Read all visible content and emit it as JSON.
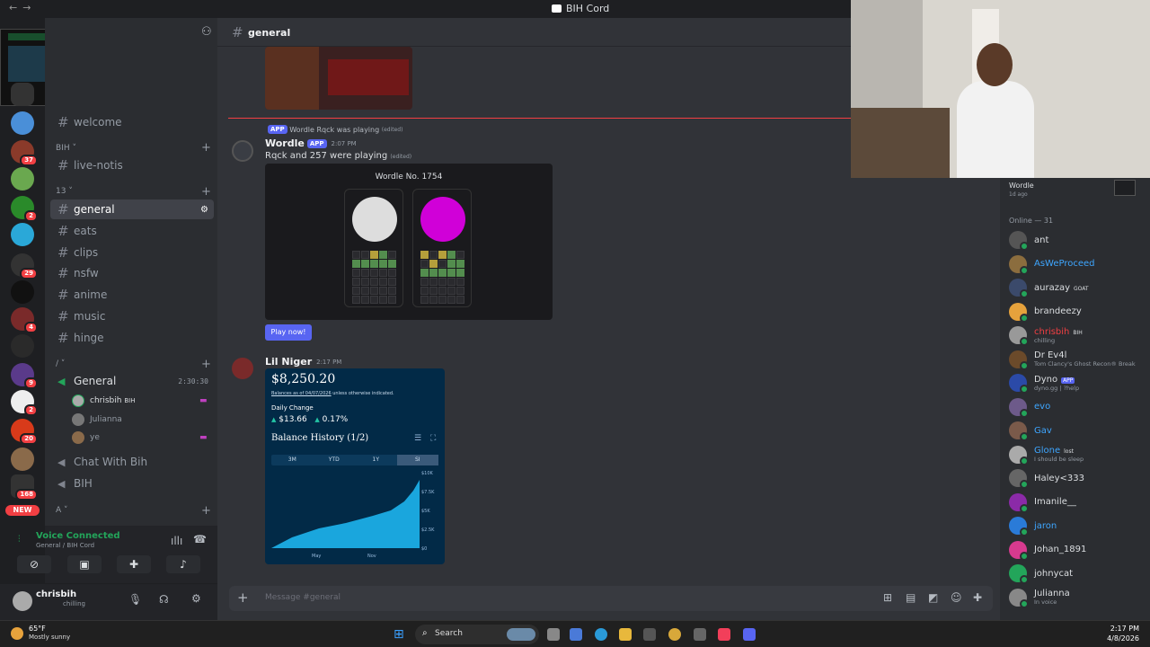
{
  "window": {
    "title": "BIH Cord"
  },
  "servers": {
    "badges": [
      "37",
      "2",
      "29",
      "4",
      "9",
      "2",
      "20",
      "168"
    ],
    "new_label": "NEW"
  },
  "channels": {
    "items": [
      {
        "name": "welcome"
      },
      {
        "name": "live-notis"
      },
      {
        "name": "general"
      },
      {
        "name": "eats"
      },
      {
        "name": "clips"
      },
      {
        "name": "nsfw"
      },
      {
        "name": "anime"
      },
      {
        "name": "music"
      },
      {
        "name": "hinge"
      }
    ],
    "cat_bih": "BIH",
    "cat_13": "13",
    "cat_slash": "/",
    "cat_a": "A",
    "voice_channel": "General",
    "voice_timer": "2:30:30",
    "voice_users": [
      {
        "name": "chrisbih",
        "tag": "BIH"
      },
      {
        "name": "Julianna"
      },
      {
        "name": "ye"
      }
    ],
    "voice2": "Chat With Bih",
    "voice3": "BIH"
  },
  "voice_panel": {
    "status": "Voice Connected",
    "location": "General / BIH Cord"
  },
  "user_panel": {
    "name": "chrisbih",
    "status": "chilling"
  },
  "header": {
    "channel": "general"
  },
  "messages": {
    "wordle_reply": "Wordle",
    "wordle_reply_text": "Rqck was playing",
    "wordle_reply_edited": "(edited)",
    "app_tag": "APP",
    "wordle_author": "Wordle",
    "wordle_time": "2:07 PM",
    "wordle_text": "Rqck and 257 were playing",
    "wordle_edited": "(edited)",
    "wordle_title": "Wordle No. 1754",
    "play_button": "Play now!",
    "lil_author": "Lil Niger",
    "lil_time": "2:17 PM",
    "balance": "$8,250.20",
    "balance_note_date": "Balances as of 04/07/2026",
    "balance_note_rest": "unless otherwise indicated.",
    "daily_label": "Daily Change",
    "daily_amount": "$13.66",
    "daily_pct": "0.17%",
    "history_title": "Balance History (1/2)",
    "tabs": [
      "3M",
      "YTD",
      "1Y",
      "SI"
    ],
    "chart_xlabels": [
      "May",
      "Nov"
    ],
    "chart_ylabels": [
      "$10K",
      "$7.5K",
      "$5K",
      "$2.5K",
      "$0"
    ]
  },
  "compose": {
    "placeholder": "Message #general"
  },
  "members": {
    "top_name": "Wordle",
    "top_status": "1d ago",
    "header": "Online — 31",
    "list": [
      {
        "name": "ant",
        "status": "",
        "color": "#dbdee1",
        "av": "#555"
      },
      {
        "name": "AsWeProceed",
        "status": "",
        "color": "#3ea6ff",
        "av": "#8b6d3e"
      },
      {
        "name": "aurazay",
        "status": "",
        "tag": "GOAT",
        "color": "#dbdee1",
        "av": "#3b4a6b"
      },
      {
        "name": "brandeezy",
        "status": "",
        "color": "#dbdee1",
        "av": "#e6a23c"
      },
      {
        "name": "chrisbih",
        "status": "chilling",
        "tag": "BIH",
        "color": "#f23f43",
        "av": "#999"
      },
      {
        "name": "Dr Ev4l",
        "status": "Tom Clancy's Ghost Recon® Break",
        "color": "#dbdee1",
        "av": "#6b4a2a"
      },
      {
        "name": "Dyno",
        "status": "dyno.gg | ?help",
        "tag": "APP",
        "color": "#dbdee1",
        "av": "#2b4aa8"
      },
      {
        "name": "evo",
        "status": "",
        "color": "#3ea6ff",
        "av": "#6d5a8a"
      },
      {
        "name": "Gav",
        "status": "",
        "color": "#3ea6ff",
        "av": "#7a5a4a"
      },
      {
        "name": "Glone",
        "status": "I should be sleep",
        "tag": "lost",
        "color": "#3ea6ff",
        "av": "#aaa"
      },
      {
        "name": "Haley<333",
        "status": "",
        "color": "#dbdee1",
        "av": "#666"
      },
      {
        "name": "Imanile__",
        "status": "",
        "color": "#dbdee1",
        "av": "#8b2aa8"
      },
      {
        "name": "jaron",
        "status": "",
        "color": "#3ea6ff",
        "av": "#2a7bd8"
      },
      {
        "name": "Johan_1891",
        "status": "",
        "color": "#dbdee1",
        "av": "#d83a8f"
      },
      {
        "name": "johnycat",
        "status": "",
        "color": "#dbdee1",
        "av": "#23a55a"
      },
      {
        "name": "Julianna",
        "status": "In voice",
        "color": "#dbdee1",
        "av": "#888"
      }
    ]
  },
  "taskbar": {
    "weather_temp": "65°F",
    "weather_desc": "Mostly sunny",
    "search": "Search",
    "time": "2:17 PM",
    "date": "4/8/2026"
  },
  "colors": {
    "accent": "#5865f2",
    "online": "#23a55a",
    "red": "#f23f43",
    "chart": "#1aa6dd"
  }
}
